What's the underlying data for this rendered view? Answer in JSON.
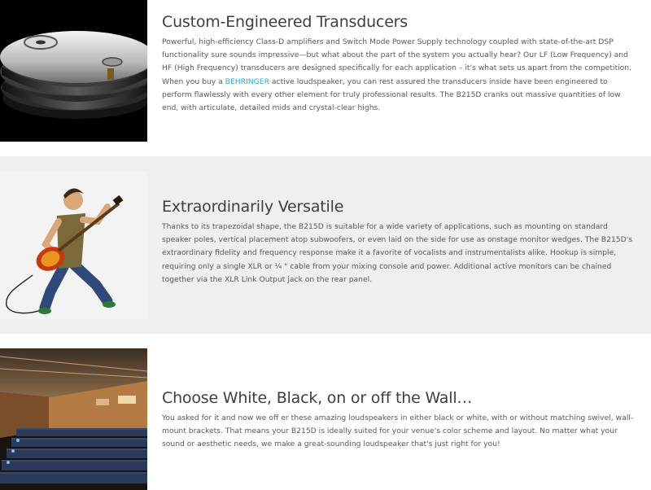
{
  "sections": [
    {
      "title": "Custom-Engineered Transducers",
      "body_before_link": "Powerful, high-efficiency Class-D amplifiers and Switch Mode Power Supply technology coupled with state-of-the-art DSP functionality sure sounds impressive—but what about the part of the system you actually hear? Our LF (Low Frequency) and HF (High Frequency) transducers are designed specifically for each application – it's what sets us apart from the competition. When you buy a ",
      "link_text": "BEHRINGER",
      "body_after_link": " active loudspeaker, you can rest assured the transducers inside have been engineered to perform flawlessly with every other element for truly professional results. The B215D cranks out massive quantities of low end, with articulate, detailed mids and crystal-clear highs.",
      "image_subject": "transducer-speaker-image"
    },
    {
      "title": "Extraordinarily Versatile",
      "body": "Thanks to its trapezoidal shape, the B215D is suitable for a wide variety of applications, such as mounting on standard speaker poles, vertical placement atop subwoofers, or even laid on the side for use as onstage monitor wedges. The B215D's extraordinary fidelity and frequency response make it a favorite of vocalists and instrumentalists alike. Hookup is simple, requiring only a single XLR or ¼ \" cable from your mixing console and power. Additional active monitors can be chained together via the XLR Link Output jack on the rear panel.",
      "image_subject": "guitarist-image"
    },
    {
      "title": "Choose White, Black, on or off the Wall…",
      "body": "You asked for it and now we off er these amazing loudspeakers in either black or white, with or without matching swivel, wall-mount brackets. That means your B215D is ideally suited for your venue's color scheme and layout. No matter what your sound or aesthetic needs, we make a great-sounding loudspeaker that's just right for you!",
      "image_subject": "auditorium-image"
    }
  ],
  "colors": {
    "link": "#29a8d8",
    "band_gray": "#efefef",
    "title": "#3e3e3e",
    "body": "#5a5a5a"
  }
}
